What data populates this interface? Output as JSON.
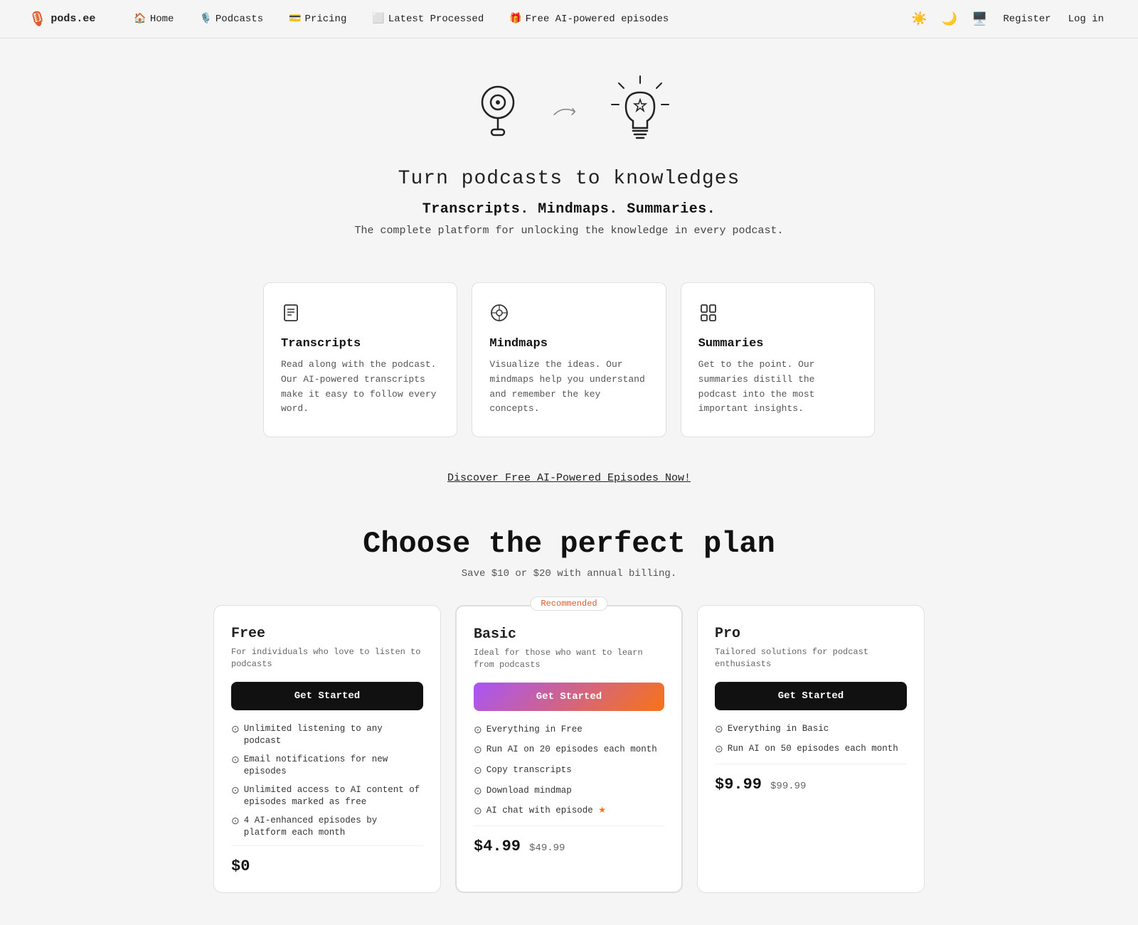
{
  "nav": {
    "logo_text": "pods.ee",
    "links": [
      {
        "id": "home",
        "label": "Home",
        "icon": "🏠"
      },
      {
        "id": "podcasts",
        "label": "Podcasts",
        "icon": "🎙️"
      },
      {
        "id": "pricing",
        "label": "Pricing",
        "icon": "💳"
      },
      {
        "id": "latest",
        "label": "Latest Processed",
        "icon": "⬜"
      },
      {
        "id": "free",
        "label": "Free AI-powered episodes",
        "icon": "🎁"
      }
    ],
    "theme_icons": [
      "☀️",
      "🌙",
      "🖥️"
    ],
    "register_label": "Register",
    "login_label": "Log in"
  },
  "hero": {
    "title": "Turn podcasts to knowledges",
    "subtitle": "Transcripts. Mindmaps. Summaries.",
    "description": "The complete platform for unlocking the knowledge in every podcast."
  },
  "features": [
    {
      "id": "transcripts",
      "icon": "📄",
      "title": "Transcripts",
      "description": "Read along with the podcast. Our AI-powered transcripts make it easy to follow every word."
    },
    {
      "id": "mindmaps",
      "icon": "🔵",
      "title": "Mindmaps",
      "description": "Visualize the ideas. Our mindmaps help you understand and remember the key concepts."
    },
    {
      "id": "summaries",
      "icon": "📋",
      "title": "Summaries",
      "description": "Get to the point. Our summaries distill the podcast into the most important insights."
    }
  ],
  "discover_link": "Discover Free AI-Powered Episodes Now!",
  "pricing": {
    "title": "Choose the perfect plan",
    "subtitle": "Save $10 or $20 with annual billing.",
    "plans": [
      {
        "id": "free",
        "name": "Free",
        "description": "For individuals who love to listen to podcasts",
        "btn_label": "Get Started",
        "btn_style": "dark",
        "recommended": false,
        "features": [
          "Unlimited listening to any podcast",
          "Email notifications for new episodes",
          "Unlimited access to AI content of episodes marked as free",
          "4 AI-enhanced episodes by platform each month"
        ],
        "price_monthly": "$0",
        "price_annual": ""
      },
      {
        "id": "basic",
        "name": "Basic",
        "description": "Ideal for those who want to learn from podcasts",
        "btn_label": "Get Started",
        "btn_style": "gradient",
        "recommended": true,
        "recommended_label": "Recommended",
        "features": [
          "Everything in Free",
          "Run AI on 20 episodes each month",
          "Copy transcripts",
          "Download mindmap",
          "AI chat with episode ★"
        ],
        "price_monthly": "$4.99",
        "price_annual": "$49.99"
      },
      {
        "id": "pro",
        "name": "Pro",
        "description": "Tailored solutions for podcast enthusiasts",
        "btn_label": "Get Started",
        "btn_style": "dark",
        "recommended": false,
        "features": [
          "Everything in Basic",
          "Run AI on 50 episodes each month"
        ],
        "price_monthly": "$9.99",
        "price_annual": "$99.99"
      }
    ]
  }
}
